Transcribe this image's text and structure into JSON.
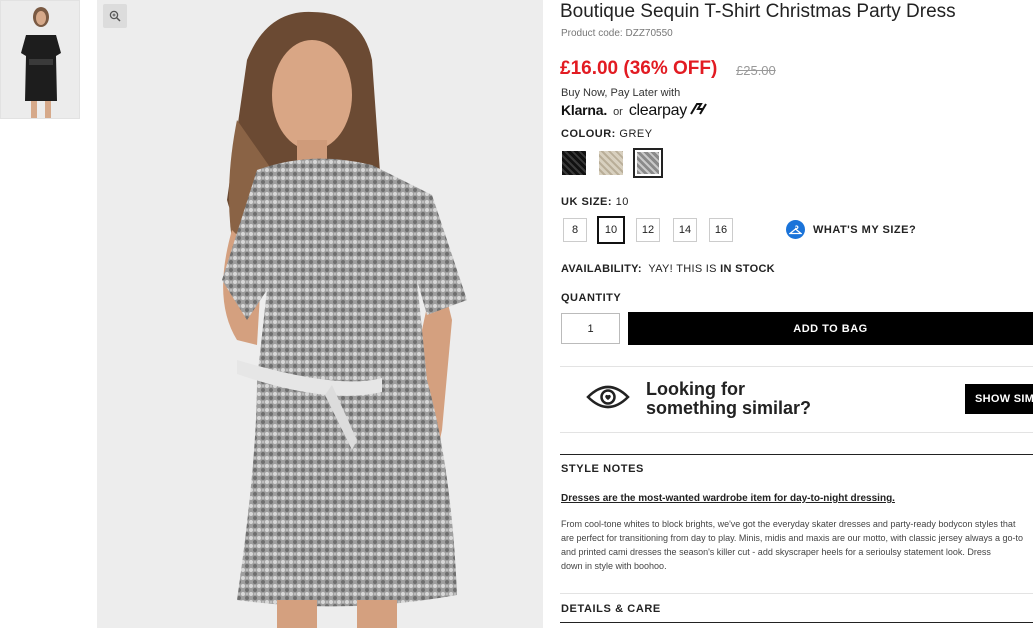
{
  "product": {
    "title": "Boutique Sequin T-Shirt Christmas Party Dress",
    "code": "Product code: DZZ70550",
    "price": "£16.00 (36% OFF)",
    "old_price": "£25.00"
  },
  "payment": {
    "pay_later": "Buy Now, Pay Later with",
    "klarna": "Klarna.",
    "or": "or",
    "clearpay": "clearpay"
  },
  "colour": {
    "label": "COLOUR:",
    "value": "GREY",
    "swatches": [
      {
        "name": "black",
        "color": "#1a1a1a"
      },
      {
        "name": "gold",
        "color": "#cfc6b2"
      },
      {
        "name": "grey",
        "color": "#a9a9a9",
        "selected": true
      }
    ]
  },
  "size": {
    "label": "UK SIZE:",
    "value": "10",
    "options": [
      "8",
      "10",
      "12",
      "14",
      "16"
    ],
    "selected": "10",
    "whats_my_size": "WHAT'S MY SIZE?"
  },
  "availability": {
    "label": "AVAILABILITY:",
    "text": "YAY! THIS IS",
    "status": "IN STOCK"
  },
  "quantity": {
    "label": "QUANTITY",
    "value": "1"
  },
  "add_to_bag": "ADD TO BAG",
  "similar": {
    "line1": "Looking for",
    "line2": "something similar?",
    "button": "SHOW SIMILAR"
  },
  "style_notes": {
    "title": "STYLE NOTES",
    "headline": "Dresses are the most-wanted wardrobe item for day-to-night dressing.",
    "body": [
      "From cool-tone whites to block brights, we've got the everyday skater dresses and party-ready bodycon styles that",
      "are perfect for transitioning from day to play. Minis, midis and maxis are our motto, with classic jersey always a go-to",
      "and printed cami dresses the season's killer cut - add skyscraper heels for a serioulsy statement look. Dress",
      "down in style with boohoo."
    ]
  },
  "details_care": "DETAILS & CARE"
}
